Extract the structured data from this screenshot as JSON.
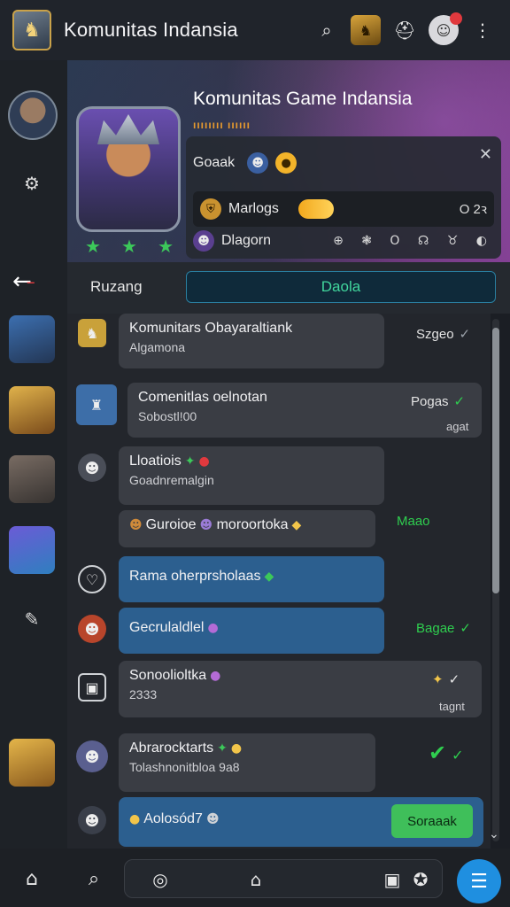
{
  "app": {
    "title": "Komunitas Indansia",
    "logo_icon": "hero-shield",
    "actions": [
      {
        "name": "search-icon",
        "glyph": "⌕"
      },
      {
        "name": "hero-badge-icon",
        "glyph": "♞"
      },
      {
        "name": "helmet-icon",
        "glyph": "⛑"
      },
      {
        "name": "profile-avatar-icon",
        "glyph": "☺"
      },
      {
        "name": "more-icon",
        "glyph": "⋮"
      }
    ]
  },
  "banner": {
    "community_title": "Komunitas Game Indansia",
    "subtitle": "ıııııııı ıııııı",
    "panel": {
      "close": "✕",
      "row1_label": "Goaak",
      "row2_label": "Marlogs",
      "row2_stat": "O 2ꝛ",
      "row3_label": "Dlagorn",
      "row3_icons": "⊕ ❃ O ☊ ♉ ◐"
    }
  },
  "tabs": {
    "back": "←",
    "rooms": "Ruzang",
    "active": "Daola"
  },
  "messages": [
    {
      "title": "Komunitars Obayaraltiank",
      "sub": "Algamona",
      "meta": "Szgeo",
      "tick": "✓"
    },
    {
      "title": "Comenitlas oelnotan",
      "sub": "Sobostl!00",
      "meta": "Pogas",
      "tick": "✓",
      "stamp": "agat"
    },
    {
      "title": "Lloatiois",
      "sub": "Goadnremalgin"
    },
    {
      "title": "Guroioe",
      "sub": "",
      "extra": "moroortoka",
      "meta": "Maao"
    },
    {
      "title": "Rama oherprsholaas"
    },
    {
      "title": "Gecrulaldlel",
      "meta": "Bagae",
      "tick": "✓"
    },
    {
      "title": "Sonoolioltka",
      "sub": "2333",
      "stamp": "tagnt"
    },
    {
      "title": "Abrarocktarts",
      "sub": "Tolashnonitbloa 9a8",
      "tick": "✓"
    },
    {
      "title": "Aolosód7",
      "button": "Soraaak"
    }
  ],
  "bottom_nav": {
    "home": "⌂",
    "search": "⌕",
    "compose": "✎",
    "chat": "☰"
  },
  "colors": {
    "accent_green": "#3fbf5a",
    "accent_blue": "#1f8fe0",
    "bubble_dark": "#3a3d44",
    "bubble_blue": "#2c5f8f",
    "badge_red": "#e0393e"
  }
}
